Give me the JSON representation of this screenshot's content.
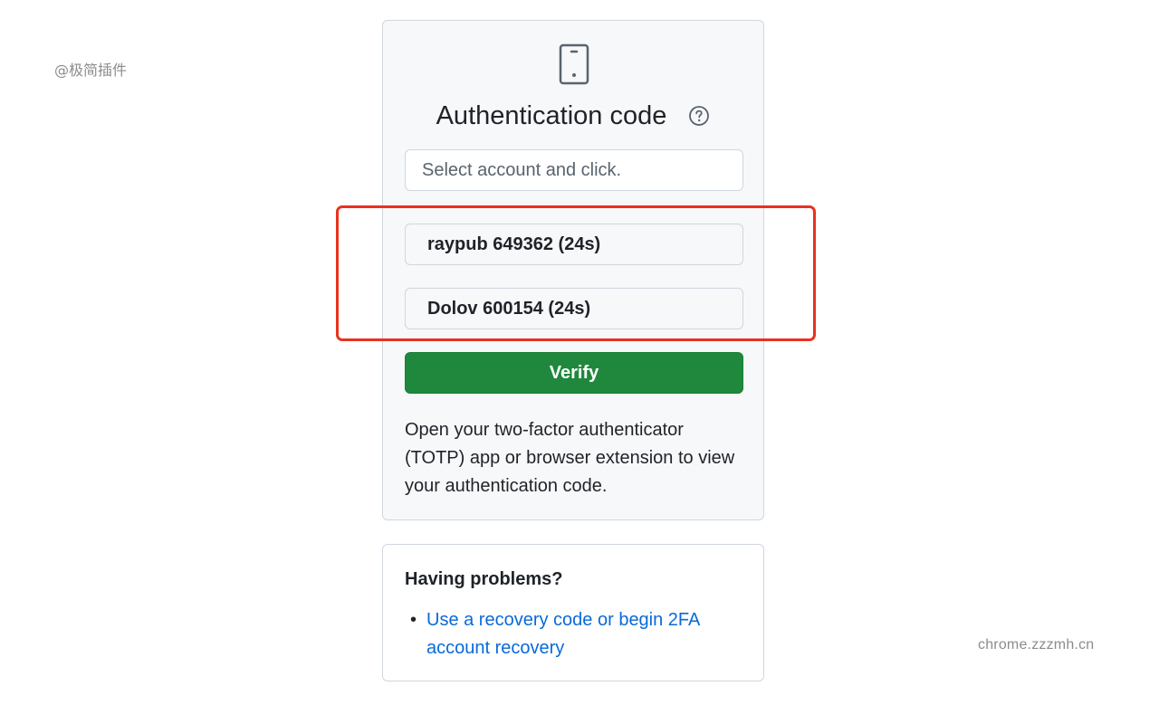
{
  "watermarks": {
    "left": "@极简插件",
    "right": "chrome.zzzmh.cn"
  },
  "auth": {
    "device_icon": "mobile-device-icon",
    "title": "Authentication code",
    "help_icon": "question-circle-icon",
    "input_placeholder": "Select account and click.",
    "input_value": "",
    "accounts": [
      {
        "label": "raypub 649362 (24s)"
      },
      {
        "label": "Dolov 600154 (24s)"
      }
    ],
    "verify_label": "Verify",
    "description": "Open your two-factor authenticator (TOTP) app or browser extension to view your authentication code."
  },
  "problems": {
    "title": "Having problems?",
    "links": [
      {
        "label": "Use a recovery code or begin 2FA account recovery"
      }
    ]
  },
  "colors": {
    "primary_green": "#1f883d",
    "link_blue": "#0969da",
    "highlight_red": "#e8321f",
    "card_bg": "#f6f8fa",
    "border": "#d0d7de"
  }
}
